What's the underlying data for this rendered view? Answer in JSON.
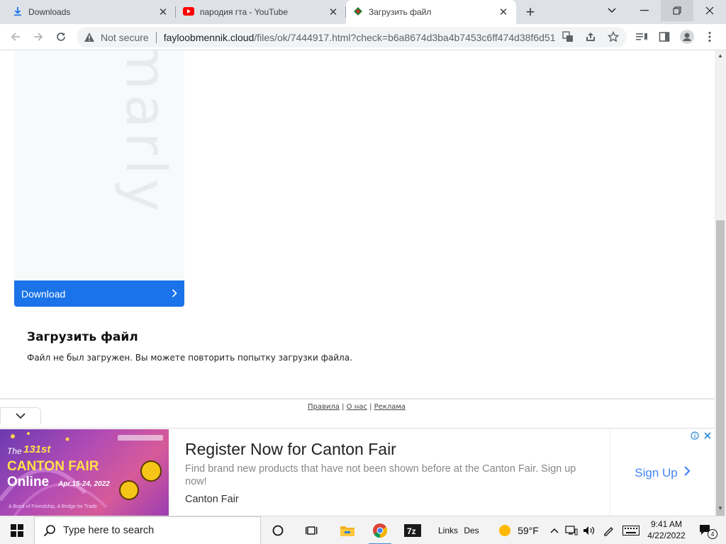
{
  "tabs": [
    {
      "label": "Downloads",
      "icon": "download-icon",
      "state": "inactive"
    },
    {
      "label": "пародия гта - YouTube",
      "icon": "youtube-icon",
      "state": "inactive"
    },
    {
      "label": "Загрузить файл",
      "icon": "site-favicon",
      "state": "active"
    }
  ],
  "omnibox": {
    "security": "Not secure",
    "host": "fayloobmennik.cloud",
    "path": "/files/ok/7444917.html?check=b6a8674d3ba4b7453c6ff474d38f6d51"
  },
  "page": {
    "watermark": "marly",
    "download_button": "Download",
    "heading": "Загрузить файл",
    "message": "Файл не был загружен. Вы можете повторить попытку загрузки файла.",
    "footer": {
      "rules": "Правила",
      "about": "О нас",
      "ads": "Реклама",
      "sep": "|"
    }
  },
  "ad": {
    "image": {
      "the": "The",
      "edition": "131st",
      "name": "CANTON FAIR",
      "online": "Online",
      "dates": "Apr.15-24, 2022",
      "tagline": "A Bond of Friendship, A Bridge for Trade"
    },
    "title": "Register Now for Canton Fair",
    "description": "Find brand new products that have not been shown before at the Canton Fair. Sign up now!",
    "source": "Canton Fair",
    "cta": "Sign Up"
  },
  "taskbar": {
    "search_placeholder": "Type here to search",
    "links": "Links",
    "des": "Des",
    "weather": "59°F",
    "time": "9:41 AM",
    "date": "4/22/2022",
    "notifications": "4"
  },
  "colors": {
    "accent": "#1a73e8",
    "tabstrip": "#dee1e6",
    "ad_link": "#4285f4"
  }
}
